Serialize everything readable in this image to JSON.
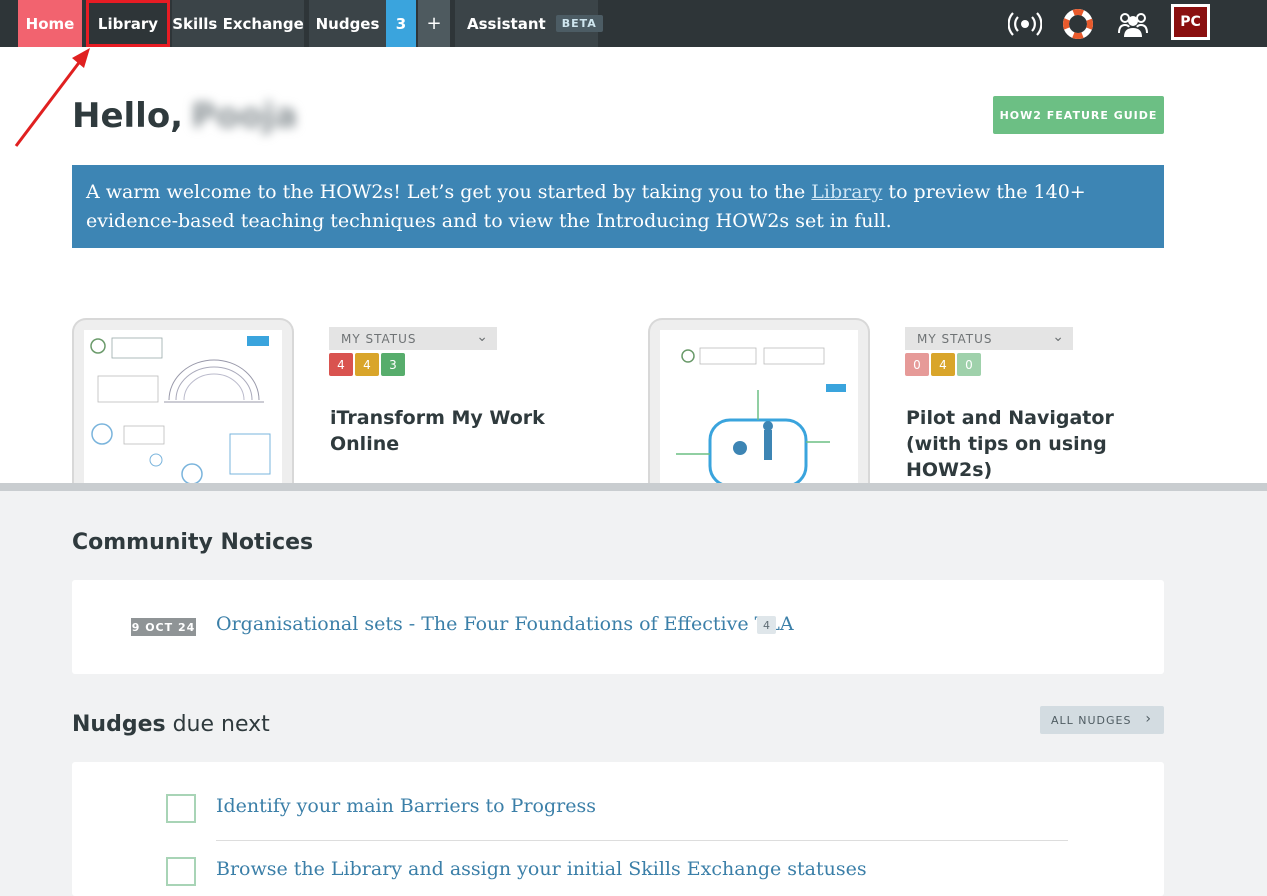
{
  "nav": {
    "home": "Home",
    "library": "Library",
    "skills_exchange": "Skills Exchange",
    "nudges": "Nudges",
    "nudges_count": "3",
    "plus": "+",
    "assistant": "Assistant",
    "beta": "BETA",
    "avatar_initials": "PC",
    "icons": [
      "broadcast-icon",
      "lifebuoy-icon",
      "users-icon"
    ]
  },
  "header": {
    "greeting": "Hello,",
    "user_name": "Pooja",
    "feature_guide_label": "HOW2 FEATURE GUIDE"
  },
  "welcome": {
    "text_before": "A warm welcome to the HOW2s! Let’s get you started by taking you to the ",
    "link": "Library",
    "text_after": " to preview the 140+ evidence-based teaching techniques and to view the Introducing HOW2s set in full."
  },
  "cards": [
    {
      "status_label": "MY STATUS",
      "badges": [
        "4",
        "4",
        "3"
      ],
      "title": "iTransform My Work Online"
    },
    {
      "status_label": "MY STATUS",
      "badges": [
        "0",
        "4",
        "0"
      ],
      "title": "Pilot and Navigator (with tips on using HOW2s)"
    }
  ],
  "community": {
    "title": "Community Notices",
    "notices": [
      {
        "date": "9 OCT 24",
        "title": "Organisational sets - The Four Foundations of Effective TLA",
        "comments": "4"
      }
    ]
  },
  "nudges": {
    "title_bold": "Nudges",
    "title_light": " due next",
    "all_label": "ALL NUDGES",
    "items": [
      "Identify your main Barriers to Progress",
      "Browse the Library and assign your initial Skills Exchange statuses"
    ]
  },
  "colors": {
    "nav_bg": "#2e3538",
    "home_accent": "#f2636f",
    "count_blue": "#3aa4dd",
    "welcome_blue": "#3d85b4",
    "feature_green": "#6cbf84",
    "badge_red": "#d9534f",
    "badge_yellow": "#d9a52a",
    "badge_green": "#57ad6c",
    "link_blue": "#3b7fa8"
  }
}
